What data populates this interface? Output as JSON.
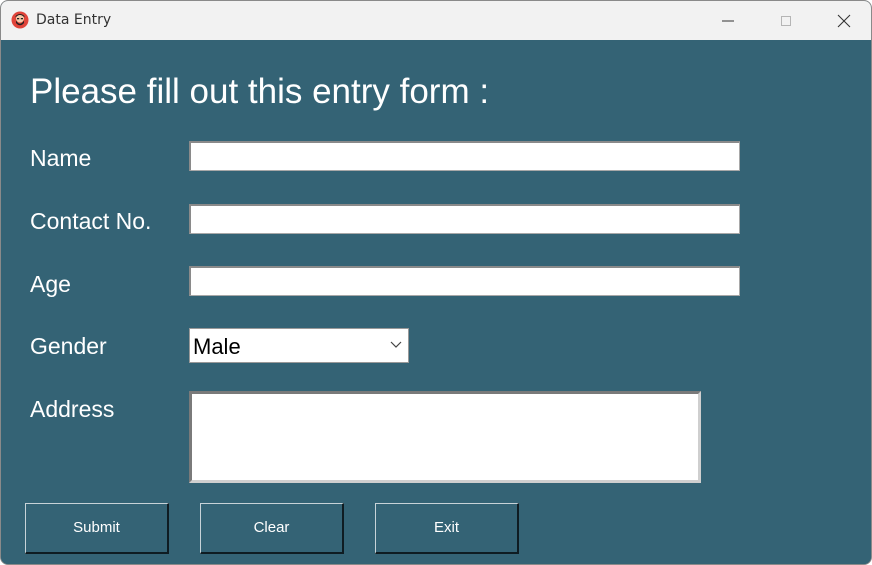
{
  "window": {
    "title": "Data Entry",
    "controls": {
      "minimize": "minimize-icon",
      "maximize": "maximize-icon",
      "close": "close-icon"
    }
  },
  "colors": {
    "background": "#346375",
    "titlebar": "#f2f2f2",
    "text": "#ffffff"
  },
  "form": {
    "heading": "Please fill out this entry form :",
    "fields": {
      "name": {
        "label": "Name",
        "value": ""
      },
      "contact": {
        "label": "Contact No.",
        "value": ""
      },
      "age": {
        "label": "Age",
        "value": ""
      },
      "gender": {
        "label": "Gender",
        "selected": "Male"
      },
      "address": {
        "label": "Address",
        "value": ""
      }
    },
    "buttons": {
      "submit": "Submit",
      "clear": "Clear",
      "exit": "Exit"
    }
  }
}
